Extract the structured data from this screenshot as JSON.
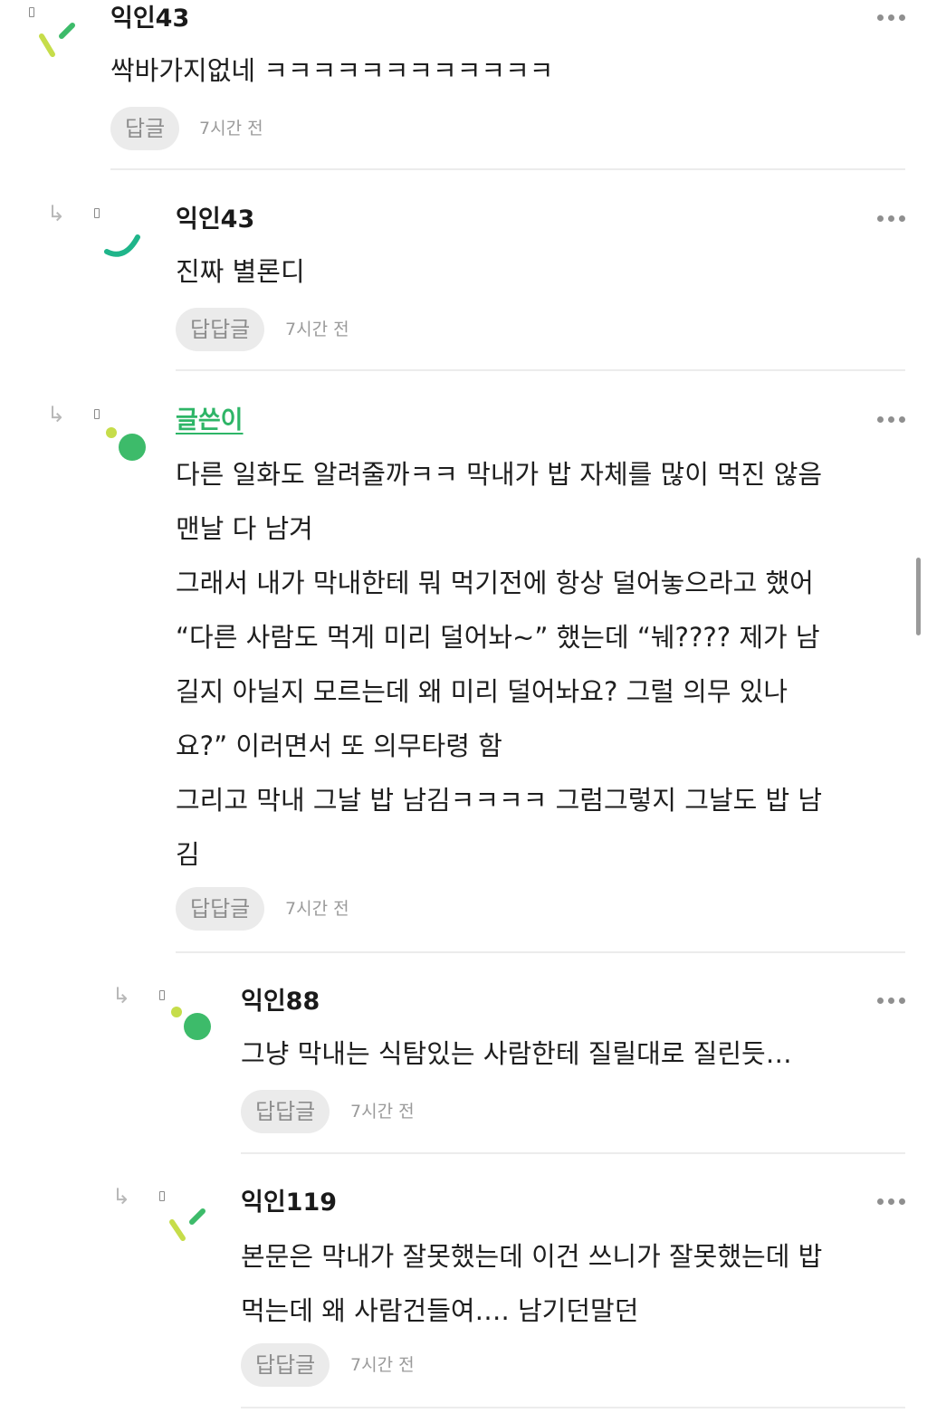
{
  "comments": [
    {
      "author": "익인43",
      "text": "싹바가지없네 ㅋㅋㅋㅋㅋㅋㅋㅋㅋㅋㅋㅋ",
      "reply_label": "답글",
      "time": "7시간 전"
    },
    {
      "author": "익인43",
      "text": "진짜 별론디",
      "reply_label": "답답글",
      "time": "7시간 전"
    },
    {
      "author": "글쓴이",
      "lines": [
        "다른 일화도 알려줄까ㅋㅋ 막내가 밥 자체를 많이 먹진 않음",
        "맨날 다 남겨",
        "그래서 내가 막내한테 뭐 먹기전에 항상 덜어놓으라고 했어",
        "“다른 사람도 먹게 미리 덜어놔~” 했는데 “눼???? 제가 남",
        "길지 아닐지 모르는데 왜 미리 덜어놔요? 그럴 의무 있나",
        "요?” 이러면서 또 의무타령 함",
        "그리고 막내 그날 밥 남김ㅋㅋㅋㅋ 그럼그렇지 그날도 밥 남",
        "김"
      ],
      "reply_label": "답답글",
      "time": "7시간 전"
    },
    {
      "author": "익인88",
      "text": "그냥 막내는 식탐있는 사람한테 질릴대로 질린듯…",
      "reply_label": "답답글",
      "time": "7시간 전"
    },
    {
      "author": "익인119",
      "lines": [
        "본문은 막내가 잘못했는데 이건 쓰니가 잘못했는데 밥",
        "먹는데 왜 사람건들여…. 남기던말던"
      ],
      "reply_label": "답답글",
      "time": "7시간 전"
    }
  ],
  "icons": {
    "reply_arrow": "reply-arrow-icon",
    "more": "more-options-icon",
    "avatar_colors": {
      "green": "#3dbb6a",
      "lime": "#c6dd4a",
      "teal": "#1fb58a"
    }
  }
}
